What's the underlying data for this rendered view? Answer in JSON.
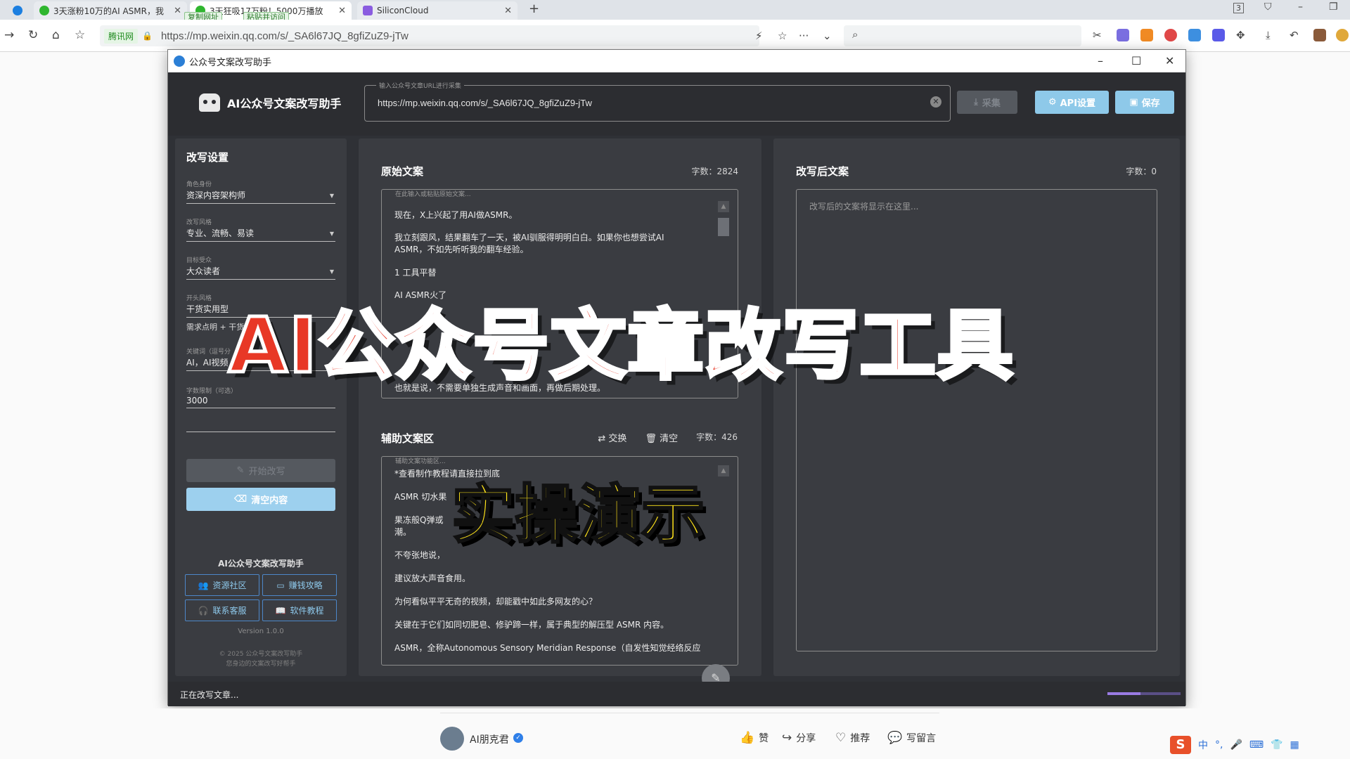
{
  "browser": {
    "tabs": [
      {
        "title": "3天涨粉10万的AI ASMR，我"
      },
      {
        "title": "3天狂吸17万粉！5000万播放"
      },
      {
        "title": "SiliconCloud"
      }
    ],
    "tab_badges": {
      "copy_url": "复制网址",
      "paste_visit": "粘贴并访问"
    },
    "tab_count": "3",
    "secure_label": "腾讯网",
    "url": "https://mp.weixin.qq.com/s/_SA6l67JQ_8gfiZuZ9-jTw"
  },
  "app": {
    "window_title": "公众号文案改写助手",
    "brand": "AI公众号文案改写助手",
    "url_field": {
      "legend": "输入公众号文章URL进行采集",
      "value": "https://mp.weixin.qq.com/s/_SA6l67JQ_8gfiZuZ9-jTw"
    },
    "buttons": {
      "collect": "采集",
      "api": "API设置",
      "save": "保存"
    },
    "settings": {
      "title": "改写设置",
      "fields": [
        {
          "label": "角色身份",
          "value": "资深内容架构师"
        },
        {
          "label": "改写风格",
          "value": "专业、流畅、易读"
        },
        {
          "label": "目标受众",
          "value": "大众读者"
        },
        {
          "label": "开头风格",
          "value": "干货实用型"
        },
        {
          "label": "关键词（逗号分",
          "value": "AI，AI视频"
        },
        {
          "label": "字数限制（可选）",
          "value": "3000"
        }
      ],
      "hint": "需求点明 + 干货",
      "start_button": "开始改写",
      "clear_button": "清空内容",
      "footer_brand": "AI公众号文案改写助手",
      "links": [
        {
          "label": "资源社区"
        },
        {
          "label": "赚钱攻略"
        },
        {
          "label": "联系客服"
        },
        {
          "label": "软件教程"
        }
      ],
      "version": "Version 1.0.0",
      "copyright": "© 2025 公众号文案改写助手",
      "tagline": "您身边的文案改写好帮手"
    },
    "original": {
      "title": "原始文案",
      "count": "字数：2824",
      "legend": "在此输入或粘贴原始文案...",
      "lines": [
        "现在，X上兴起了用AI做ASMR。",
        "我立刻跟风，结果翻车了一天，被AI驯服得明明白白。如果你也想尝试AI",
        "ASMR，不如先听听我的翻车经验。",
        "1 工具平替",
        "AI ASMR火了",
        "也就是说，不需要单独生成声音和画面，再做后期处理。"
      ]
    },
    "aux": {
      "title": "辅助文案区",
      "swap": "交换",
      "clear": "清空",
      "count": "字数：426",
      "legend": "辅助文案功能区...",
      "lines": [
        "*查看制作教程请直接拉到底",
        "ASMR 切水果",
        "果冻般Q弹或",
        "潮。",
        "不夸张地说，",
        "建议放大声音食用。",
        "为何看似平平无奇的视频，却能戳中如此多网友的心？",
        "关键在于它们如同切肥皂、修驴蹄一样，属于典型的解压型 ASMR 内容。",
        "ASMR，全称Autonomous Sensory Meridian Response（自发性知觉经络反应"
      ]
    },
    "rewritten": {
      "title": "改写后文案",
      "count": "字数：0",
      "placeholder": "改写后的文案将显示在这里..."
    },
    "status": "正在改写文章...",
    "progress": 0.45
  },
  "overlay": {
    "title": "AI公众号文章改写工具",
    "subtitle": "实操演示"
  },
  "wechat": {
    "author": "AI朋克君",
    "actions": [
      "赞",
      "分享",
      "推荐",
      "写留言"
    ]
  },
  "ime": {
    "logo": "S",
    "lang": "中"
  },
  "colors": {
    "app_bg": "#2f3136",
    "panel_bg": "#3a3c41",
    "accent_button": "#8ec9e9",
    "overlay_red": "#e83826",
    "overlay_yellow": "#ffe31a"
  }
}
